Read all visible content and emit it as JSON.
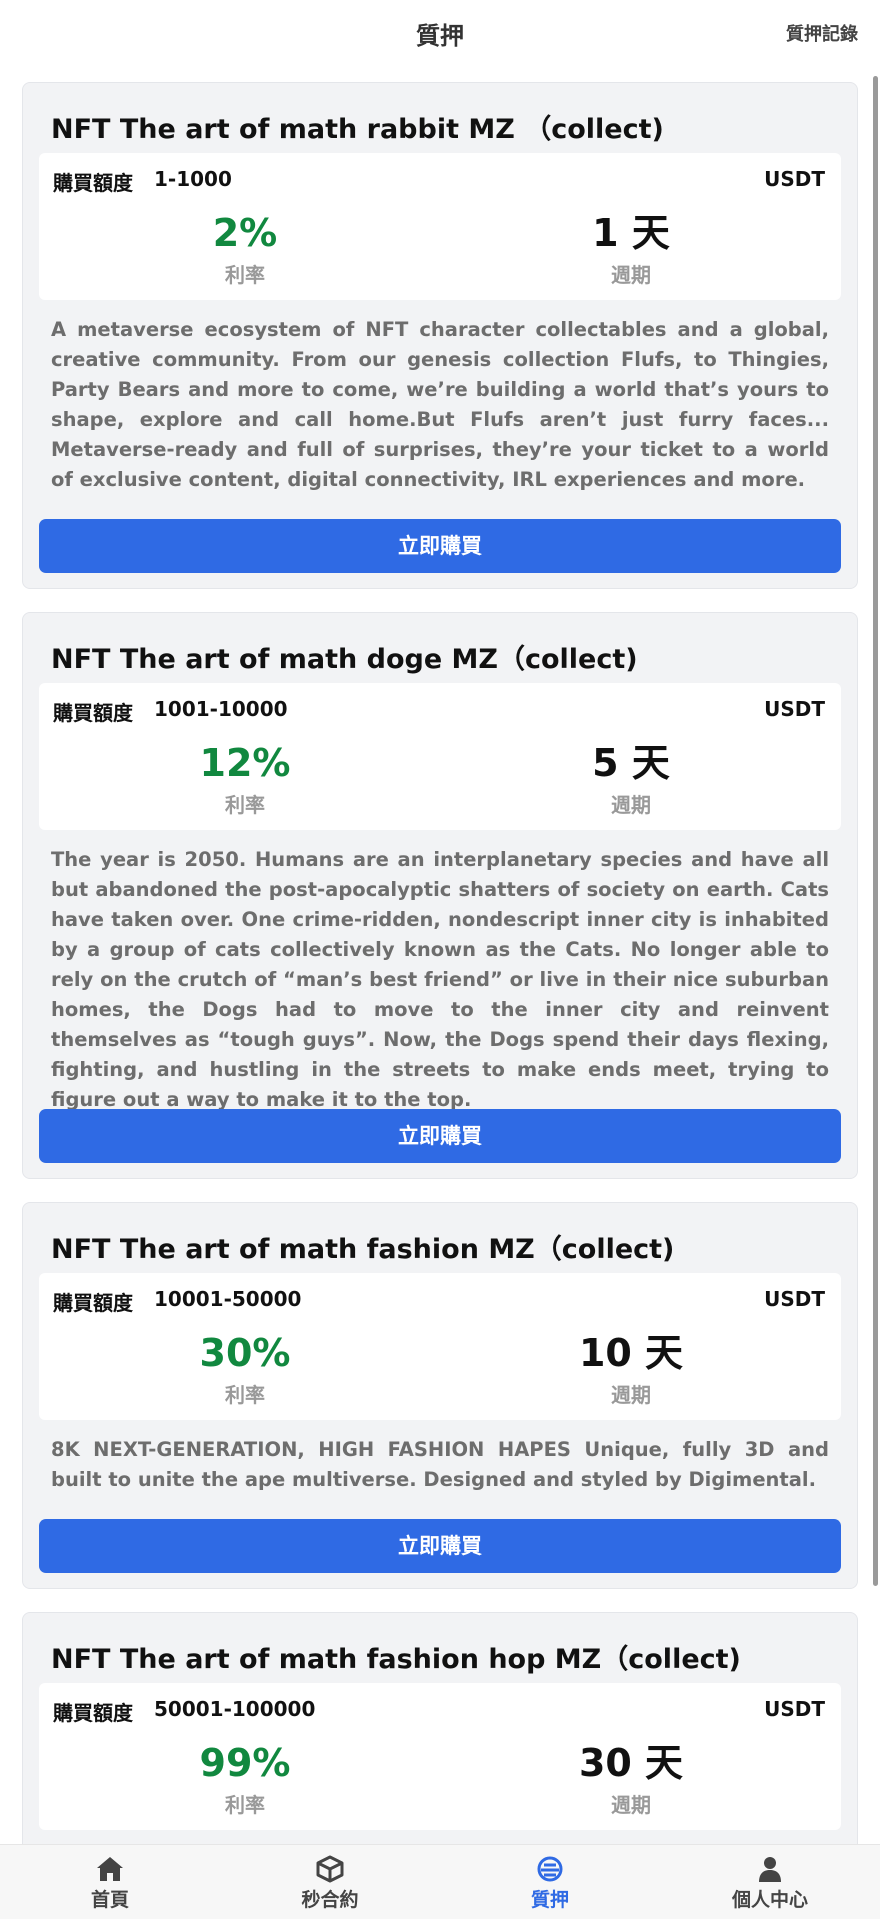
{
  "header": {
    "title": "質押",
    "record_link": "質押記錄"
  },
  "cards": [
    {
      "title": "NFT The art of math rabbit MZ （collect)",
      "quota_label": "購買額度",
      "quota_value": "1-1000",
      "currency": "USDT",
      "rate": "2%",
      "rate_label": "利率",
      "period": "1 天",
      "period_label": "週期",
      "description": "A metaverse ecosystem of NFT character collectables and a global, creative community. From our genesis collection Flufs, to Thingies, Party Bears and more to come, we’re building a world that’s yours to shape, explore and call home.But Flufs aren’t just furry faces... Metaverse-ready and full of surprises, they’re your ticket to a world of exclusive content, digital connectivity, IRL experiences and more.",
      "button": "立即購買"
    },
    {
      "title": "NFT The art of math doge MZ（collect)",
      "quota_label": "購買額度",
      "quota_value": "1001-10000",
      "currency": "USDT",
      "rate": "12%",
      "rate_label": "利率",
      "period": "5 天",
      "period_label": "週期",
      "description": "The year is 2050. Humans are an interplanetary species and have all but abandoned the post-apocalyptic shatters of society on earth. Cats have taken over. One crime-ridden, nondescript inner city is inhabited by a group of cats collectively known as the Cats. No longer able to rely on the crutch of “man’s best friend” or live in their nice suburban homes, the Dogs had to move to the inner city and reinvent themselves as “tough guys”. Now, the Dogs spend their days flexing, fighting, and hustling in the streets to make ends meet, trying to figure out a way to make it to the top.",
      "button": "立即購買"
    },
    {
      "title": "NFT The art of math fashion MZ（collect)",
      "quota_label": "購買額度",
      "quota_value": "10001-50000",
      "currency": "USDT",
      "rate": "30%",
      "rate_label": "利率",
      "period": "10 天",
      "period_label": "週期",
      "description": "8K NEXT-GENERATION, HIGH FASHION HAPES Unique, fully 3D and built to unite the ape multiverse. Designed and styled by Digimental.",
      "button": "立即購買"
    },
    {
      "title": "NFT The art of math fashion hop MZ（collect)",
      "quota_label": "購買額度",
      "quota_value": "50001-100000",
      "currency": "USDT",
      "rate": "99%",
      "rate_label": "利率",
      "period": "30 天",
      "period_label": "週期"
    }
  ],
  "tabbar": [
    {
      "label": "首頁",
      "icon": "home-icon"
    },
    {
      "label": "秒合約",
      "icon": "cube-icon"
    },
    {
      "label": "質押",
      "icon": "stake-icon",
      "active": true
    },
    {
      "label": "個人中心",
      "icon": "user-icon"
    }
  ],
  "colors": {
    "accent": "#2f6ae4",
    "rate_green": "#11883f",
    "card_bg": "#f2f3f5"
  }
}
